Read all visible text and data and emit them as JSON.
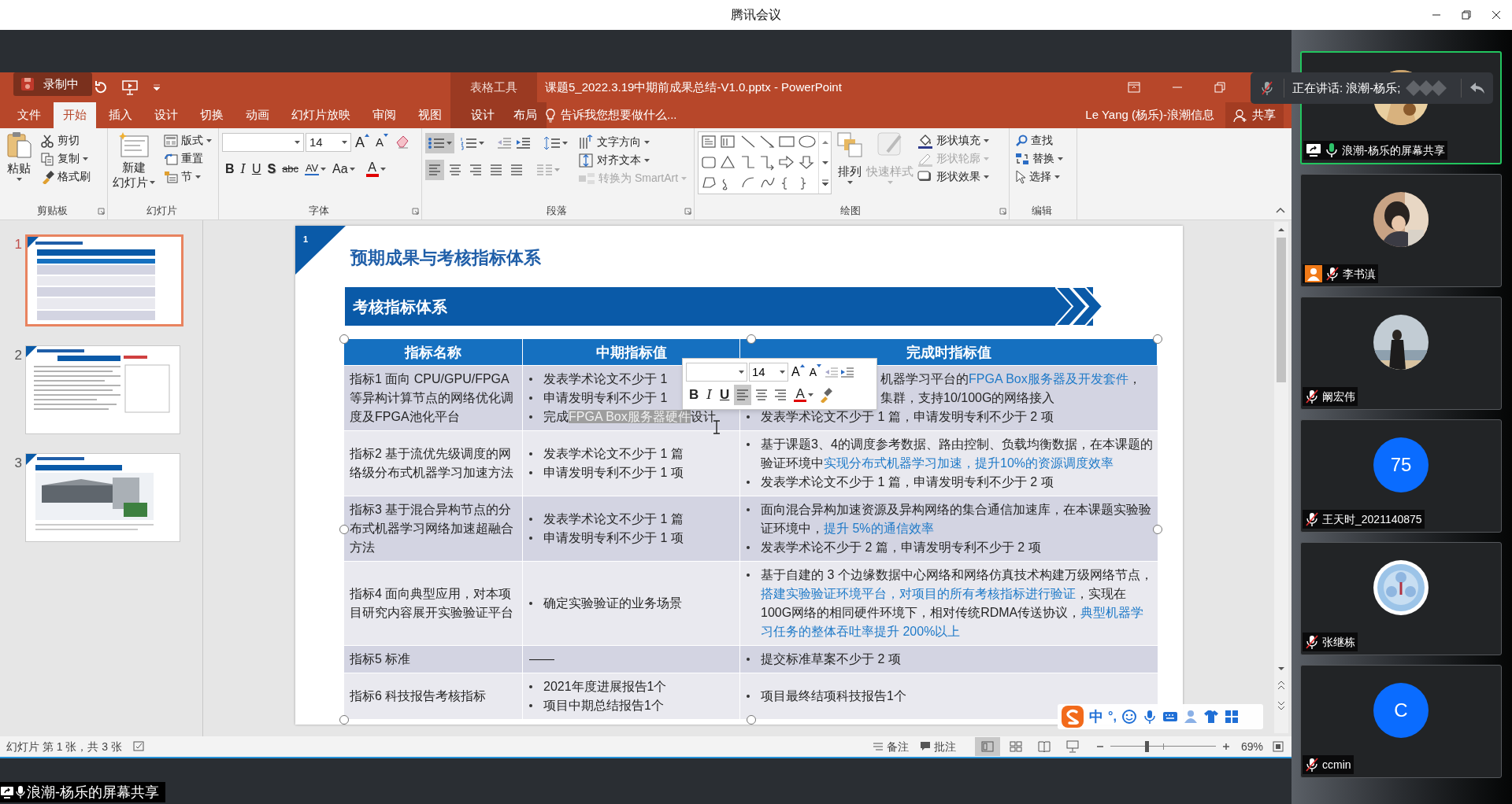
{
  "meeting": {
    "title": "腾讯会议",
    "recording_label": "录制中",
    "speaking_label": "正在讲话: 浪潮-杨乐;",
    "share_label": "浪潮-杨乐的屏幕共享"
  },
  "powerpoint": {
    "contextual_group": "表格工具",
    "document_title": "课题5_2022.3.19中期前成果总结-V1.0.pptx - PowerPoint",
    "user": "Le Yang (杨乐)-浪潮信息",
    "share_button": "共享",
    "tell_me": "告诉我您想要做什么...",
    "tabs": [
      {
        "label": "文件",
        "selected": false,
        "contextual": false
      },
      {
        "label": "开始",
        "selected": true,
        "contextual": false
      },
      {
        "label": "插入",
        "selected": false,
        "contextual": false
      },
      {
        "label": "设计",
        "selected": false,
        "contextual": false
      },
      {
        "label": "切换",
        "selected": false,
        "contextual": false
      },
      {
        "label": "动画",
        "selected": false,
        "contextual": false
      },
      {
        "label": "幻灯片放映",
        "selected": false,
        "contextual": false
      },
      {
        "label": "审阅",
        "selected": false,
        "contextual": false
      },
      {
        "label": "视图",
        "selected": false,
        "contextual": false
      },
      {
        "label": "设计",
        "selected": false,
        "contextual": true
      },
      {
        "label": "布局",
        "selected": false,
        "contextual": true
      }
    ],
    "ribbon": {
      "clipboard": {
        "label": "剪贴板",
        "paste": "粘贴",
        "commands": [
          {
            "kind": "cut",
            "label": "剪切",
            "dropdown": false
          },
          {
            "kind": "copy",
            "label": "复制",
            "dropdown": true
          },
          {
            "kind": "painter",
            "label": "格式刷",
            "dropdown": false
          }
        ]
      },
      "slides": {
        "label": "幻灯片",
        "new_slide": [
          "新建",
          "幻灯片"
        ],
        "commands": [
          {
            "kind": "layout",
            "label": "版式",
            "dropdown": true
          },
          {
            "kind": "reset",
            "label": "重置",
            "dropdown": false
          },
          {
            "kind": "section",
            "label": "节",
            "dropdown": true
          }
        ]
      },
      "font": {
        "label": "字体",
        "size": "14",
        "grow": "A",
        "shrink": "A",
        "buttons": [
          {
            "kind": "bold",
            "label": "B"
          },
          {
            "kind": "italic",
            "label": "I"
          },
          {
            "kind": "underline",
            "label": "U"
          },
          {
            "kind": "shadow",
            "label": "S"
          },
          {
            "kind": "strike",
            "label": "abc"
          },
          {
            "kind": "spacing",
            "label": "AV"
          },
          {
            "kind": "case",
            "label": "Aa"
          },
          {
            "kind": "color",
            "label": "A"
          }
        ]
      },
      "paragraph": {
        "label": "段落",
        "bullets_active": true,
        "align_buttons": [
          {
            "kind": "left",
            "selected": true
          },
          {
            "kind": "center",
            "selected": false
          },
          {
            "kind": "right",
            "selected": false
          },
          {
            "kind": "justify",
            "selected": false
          },
          {
            "kind": "distributed",
            "selected": false
          }
        ],
        "commands": [
          {
            "kind": "direction",
            "label": "文字方向",
            "disabled": false
          },
          {
            "kind": "align_text",
            "label": "对齐文本",
            "disabled": false
          },
          {
            "kind": "smartart",
            "label": "转换为 SmartArt",
            "disabled": true
          }
        ]
      },
      "drawing": {
        "label": "绘图",
        "big": [
          {
            "kind": "arrange",
            "label": "排列",
            "disabled": false
          },
          {
            "kind": "styles",
            "label": "快速样式",
            "disabled": true
          }
        ],
        "commands": [
          {
            "kind": "fill",
            "label": "形状填充",
            "disabled": false
          },
          {
            "kind": "outline",
            "label": "形状轮廓",
            "disabled": true
          },
          {
            "kind": "effects",
            "label": "形状效果",
            "disabled": false
          }
        ]
      },
      "editing": {
        "label": "编辑",
        "commands": [
          {
            "kind": "find",
            "label": "查找",
            "dropdown": false
          },
          {
            "kind": "replace",
            "label": "替换",
            "dropdown": true
          },
          {
            "kind": "select",
            "label": "选择",
            "dropdown": true
          }
        ]
      }
    },
    "thumbnails": [
      {
        "number": "1",
        "selected": true,
        "kind": "table"
      },
      {
        "number": "2",
        "selected": false,
        "kind": "list"
      },
      {
        "number": "3",
        "selected": false
      }
    ],
    "slide": {
      "number": "1",
      "title": "预期成果与考核指标体系",
      "banner": "考核指标体系",
      "table": {
        "columns": [
          "指标名称",
          "中期指标值",
          "完成时指标值"
        ],
        "rows": [
          {
            "name": "指标1 面向 CPU/GPU/FPGA 等异构计算节点的网络优化调度及FPGA池化平台",
            "mid": [
              {
                "kind": "bullet",
                "parts": [
                  {
                    "text": "发表学术论文不少于 1",
                    "kind": "normal"
                  }
                ]
              },
              {
                "kind": "bullet",
                "parts": [
                  {
                    "text": "申请发明专利不少于 1",
                    "kind": "normal"
                  }
                ]
              },
              {
                "kind": "bullet",
                "parts": [
                  {
                    "text": "完成",
                    "kind": "normal"
                  },
                  {
                    "text": "FPGA Box服务器硬件",
                    "kind": "selected"
                  },
                  {
                    "text": "设计",
                    "kind": "normal"
                  }
                ]
              }
            ],
            "final": [
              {
                "kind": "clipped",
                "parts": [
                  {
                    "text": "机器学习平台的",
                    "kind": "normal"
                  },
                  {
                    "text": "FPGA Box服务器及开发套件",
                    "kind": "emphasis"
                  },
                  {
                    "text": "，",
                    "kind": "normal"
                  }
                ]
              },
              {
                "kind": "clipped",
                "parts": [
                  {
                    "text": "集群，支持10/100G的网络接入",
                    "kind": "normal"
                  }
                ]
              },
              {
                "kind": "bullet",
                "parts": [
                  {
                    "text": "发表学术论文不少于 1 篇，申请发明专利不少于 2 项",
                    "kind": "normal"
                  }
                ]
              }
            ]
          },
          {
            "name": "指标2 基于流优先级调度的网络级分布式机器学习加速方法",
            "mid": [
              {
                "kind": "bullet",
                "parts": [
                  {
                    "text": "发表学术论文不少于 1 篇",
                    "kind": "normal"
                  }
                ]
              },
              {
                "kind": "bullet",
                "parts": [
                  {
                    "text": "申请发明专利不少于 1 项",
                    "kind": "normal"
                  }
                ]
              }
            ],
            "final": [
              {
                "kind": "bullet",
                "parts": [
                  {
                    "text": "基于课题3、4的调度参考数据、路由控制、负载均衡数据，在本课题的验证环境中",
                    "kind": "normal"
                  },
                  {
                    "text": "实现分布式机器学习加速，提升10%的资源调度效率",
                    "kind": "emphasis"
                  }
                ]
              },
              {
                "kind": "bullet",
                "parts": [
                  {
                    "text": "发表学术论文不少于 1 篇，申请发明专利不少于 2 项",
                    "kind": "normal"
                  }
                ]
              }
            ]
          },
          {
            "name": "指标3 基于混合异构节点的分布式机器学习网络加速超融合方法",
            "mid": [
              {
                "kind": "bullet",
                "parts": [
                  {
                    "text": "发表学术论文不少于 1 篇",
                    "kind": "normal"
                  }
                ]
              },
              {
                "kind": "bullet",
                "parts": [
                  {
                    "text": "申请发明专利不少于 1 项",
                    "kind": "normal"
                  }
                ]
              }
            ],
            "final": [
              {
                "kind": "bullet",
                "parts": [
                  {
                    "text": "面向混合异构加速资源及异构网络的集合通信加速库，在本课题实验验证环境中，",
                    "kind": "normal"
                  },
                  {
                    "text": "提升 5%的通信效率",
                    "kind": "emphasis"
                  }
                ]
              },
              {
                "kind": "bullet",
                "parts": [
                  {
                    "text": "发表学术论不少于 2 篇，申请发明专利不少于 2 项",
                    "kind": "normal"
                  }
                ]
              }
            ]
          },
          {
            "name": "指标4 面向典型应用，对本项目研究内容展开实验验证平台",
            "mid": [
              {
                "kind": "bullet",
                "parts": [
                  {
                    "text": "确定实验验证的业务场景",
                    "kind": "normal"
                  }
                ]
              }
            ],
            "final": [
              {
                "kind": "bullet",
                "parts": [
                  {
                    "text": "基于自建的 3 个边缘数据中心网络和网络仿真技术构建万级网络节点，",
                    "kind": "normal"
                  },
                  {
                    "text": "搭建实验验证环境平台，对项目的所有考核指标进行验证",
                    "kind": "emphasis"
                  },
                  {
                    "text": "，实现在100G网络的相同硬件环境下，相对传统RDMA传送协议，",
                    "kind": "normal"
                  },
                  {
                    "text": "典型机器学习任务的整体吞吐率提升 200%以上",
                    "kind": "emphasis"
                  }
                ]
              }
            ]
          },
          {
            "name": "指标5 标准",
            "mid": [
              {
                "kind": "plain",
                "parts": [
                  {
                    "text": "——",
                    "kind": "normal"
                  }
                ]
              }
            ],
            "final": [
              {
                "kind": "bullet",
                "parts": [
                  {
                    "text": "提交标准草案不少于 2 项",
                    "kind": "normal"
                  }
                ]
              }
            ]
          },
          {
            "name": "指标6 科技报告考核指标",
            "mid": [
              {
                "kind": "bullet",
                "parts": [
                  {
                    "text": "2021年度进展报告1个",
                    "kind": "normal"
                  }
                ]
              },
              {
                "kind": "bullet",
                "parts": [
                  {
                    "text": "项目中期总结报告1个",
                    "kind": "normal"
                  }
                ]
              }
            ],
            "final": [
              {
                "kind": "bullet",
                "parts": [
                  {
                    "text": "项目最终结项科技报告1个",
                    "kind": "normal"
                  }
                ]
              }
            ]
          }
        ]
      }
    },
    "mini_toolbar": {
      "size": "14",
      "grow": "A",
      "shrink": "A",
      "buttons": [
        {
          "kind": "bold",
          "label": "B"
        },
        {
          "kind": "italic",
          "label": "I"
        },
        {
          "kind": "underline",
          "label": "U"
        },
        {
          "kind": "color",
          "label": "A"
        }
      ],
      "align_buttons": [
        {
          "kind": "left",
          "selected": true
        },
        {
          "kind": "center",
          "selected": false
        },
        {
          "kind": "right",
          "selected": false
        }
      ]
    },
    "status_bar": {
      "slide_counter": "幻灯片 第 1 张，共 3 张",
      "notes": "备注",
      "comments": "批注",
      "views": [
        {
          "kind": "normal",
          "selected": true
        },
        {
          "kind": "sorter",
          "selected": false
        },
        {
          "kind": "reading",
          "selected": false
        },
        {
          "kind": "show",
          "selected": false
        }
      ],
      "zoom": {
        "level": 0.33,
        "text": "69%"
      }
    }
  },
  "ime": {
    "mode": "中",
    "punctuation": "°,"
  },
  "participants": [
    {
      "name": "浪潮-杨乐的屏幕共享",
      "muted": false,
      "sharing": true,
      "host": false,
      "active": true
    },
    {
      "name": "李书滇",
      "muted": true,
      "sharing": false,
      "host": true,
      "active": false
    },
    {
      "name": "阚宏伟",
      "muted": true,
      "sharing": false,
      "host": false,
      "active": false
    },
    {
      "name": "王天时_2021140875",
      "muted": true,
      "sharing": false,
      "host": false,
      "active": false,
      "avatar": {
        "kind": "initials",
        "text": "75"
      }
    },
    {
      "name": "张继栋",
      "muted": true,
      "sharing": false,
      "host": false,
      "active": false
    },
    {
      "name": "ccmin",
      "muted": true,
      "sharing": false,
      "host": false,
      "active": false,
      "avatar": {
        "kind": "initials",
        "text": "C"
      }
    }
  ]
}
